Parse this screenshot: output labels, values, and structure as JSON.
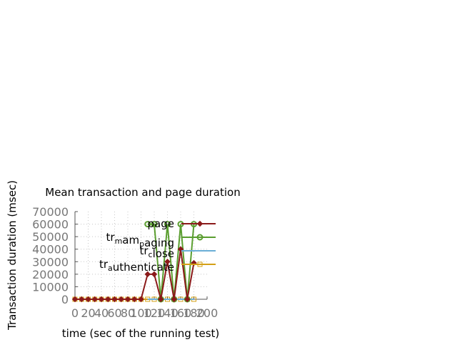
{
  "chart_data": {
    "type": "line",
    "title": "Mean transaction and page duration",
    "xlabel": "time (sec of the running test)",
    "ylabel": "Transaction duration (msec)",
    "xlim": [
      0,
      200
    ],
    "ylim": [
      0,
      70000
    ],
    "xticks": [
      "0",
      "20",
      "40",
      "60",
      "80",
      "100",
      "120",
      "140",
      "160",
      "180",
      "200"
    ],
    "yticks": [
      "0",
      "10000",
      "20000",
      "30000",
      "40000",
      "50000",
      "60000",
      "70000"
    ],
    "grid": true,
    "legend_position": "top-right",
    "x": [
      0,
      10,
      20,
      30,
      40,
      50,
      60,
      70,
      80,
      90,
      100,
      110,
      120,
      130,
      140,
      150,
      160,
      170,
      180
    ],
    "series": [
      {
        "name": "page",
        "legend_parts": [
          {
            "t": "page",
            "sub": false
          }
        ],
        "color": "#8b1a1a",
        "marker": "diamond",
        "values": [
          0,
          0,
          0,
          0,
          0,
          0,
          0,
          0,
          0,
          0,
          0,
          20000,
          20000,
          0,
          30000,
          0,
          40000,
          0,
          29000
        ]
      },
      {
        "name": "tr_mam_paging",
        "legend_parts": [
          {
            "t": "tr",
            "sub": false
          },
          {
            "t": "m",
            "sub": true
          },
          {
            "t": "am",
            "sub": false
          },
          {
            "t": "p",
            "sub": true
          },
          {
            "t": "aging",
            "sub": false
          }
        ],
        "color": "#5a9e2f",
        "marker": "circle",
        "values": [
          null,
          null,
          null,
          null,
          null,
          null,
          null,
          null,
          null,
          null,
          null,
          60000,
          60000,
          0,
          60000,
          0,
          60000,
          0,
          60000
        ]
      },
      {
        "name": "tr_close",
        "legend_parts": [
          {
            "t": "tr",
            "sub": false
          },
          {
            "t": "c",
            "sub": true
          },
          {
            "t": "lose",
            "sub": false
          }
        ],
        "color": "#6aaed6",
        "marker": "none",
        "values": [
          null,
          null,
          null,
          null,
          null,
          null,
          null,
          null,
          null,
          null,
          null,
          0,
          0,
          0,
          0,
          0,
          0,
          0,
          0
        ]
      },
      {
        "name": "tr_authenticate",
        "legend_parts": [
          {
            "t": "tr",
            "sub": false
          },
          {
            "t": "a",
            "sub": true
          },
          {
            "t": "uthenticate",
            "sub": false
          }
        ],
        "color": "#d4a017",
        "marker": "square",
        "values": [
          0,
          0,
          0,
          0,
          0,
          0,
          0,
          0,
          0,
          0,
          0,
          0,
          0,
          0,
          0,
          0,
          0,
          0,
          0
        ]
      }
    ]
  }
}
